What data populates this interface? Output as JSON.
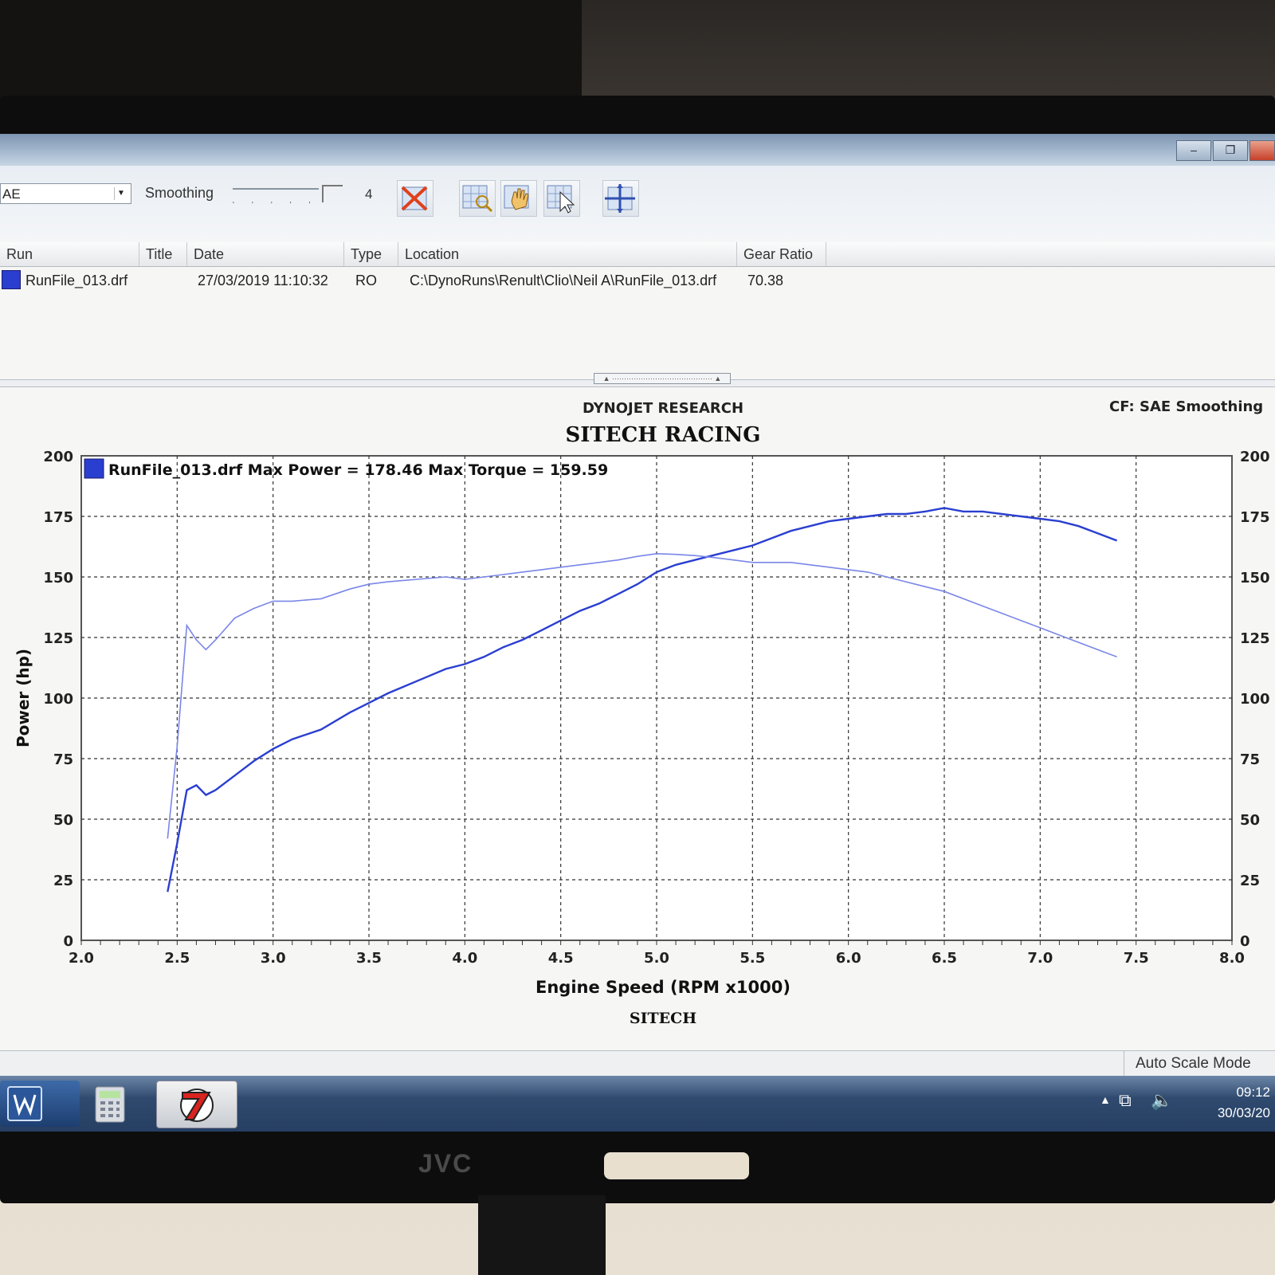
{
  "window": {
    "minimize_glyph": "–",
    "restore_glyph": "❐"
  },
  "toolbar": {
    "cf_value": "AE",
    "smoothing_label": "Smoothing",
    "smoothing_value": "4",
    "buttons": [
      "clear-runs-icon",
      "zoom-icon",
      "pan-hand-icon",
      "cursor-select-icon",
      "crosshair-icon"
    ]
  },
  "grid": {
    "headers": {
      "run": "Run",
      "title": "Title",
      "date": "Date",
      "type": "Type",
      "location": "Location",
      "gear_ratio": "Gear Ratio"
    },
    "rows": [
      {
        "run": "RunFile_013.drf",
        "title": "",
        "date": "27/03/2019 11:10:32",
        "type": "RO",
        "location": "C:\\DynoRuns\\Renult\\Clio\\Neil A\\RunFile_013.drf",
        "gear_ratio": "70.38",
        "color": "#2a3fd0"
      }
    ]
  },
  "status": {
    "auto_scale": "Auto Scale Mode"
  },
  "taskbar": {
    "time": "09:12",
    "date": "30/03/20"
  },
  "monitor": {
    "brand": "JVC"
  },
  "chart_data": {
    "type": "line",
    "header_small": "DYNOJET RESEARCH",
    "title": "SITECH RACING",
    "footer": "SITECH",
    "cf_info": "CF: SAE  Smoothing",
    "xlabel": "Engine Speed (RPM x1000)",
    "ylabel": "Power (hp)",
    "xlim": [
      2.0,
      8.0
    ],
    "ylim": [
      0,
      200
    ],
    "x_ticks": [
      "2.0",
      "2.5",
      "3.0",
      "3.5",
      "4.0",
      "4.5",
      "5.0",
      "5.5",
      "6.0",
      "6.5",
      "7.0",
      "7.5",
      "8.0"
    ],
    "y_ticks": [
      "0",
      "25",
      "50",
      "75",
      "100",
      "125",
      "150",
      "175",
      "200"
    ],
    "y2_ticks": [
      "0",
      "25",
      "50",
      "75",
      "100",
      "125",
      "150",
      "175",
      "200"
    ],
    "grid": true,
    "legend": {
      "position": "top-left",
      "text": "RunFile_013.drf Max Power = 178.46 Max Torque = 159.59"
    },
    "series": [
      {
        "role": "power",
        "color": "#2a3fd0",
        "x": [
          2.45,
          2.5,
          2.55,
          2.6,
          2.65,
          2.7,
          2.8,
          2.9,
          3.0,
          3.1,
          3.25,
          3.4,
          3.5,
          3.6,
          3.75,
          3.9,
          4.0,
          4.1,
          4.2,
          4.3,
          4.4,
          4.5,
          4.6,
          4.7,
          4.8,
          4.9,
          5.0,
          5.1,
          5.2,
          5.3,
          5.4,
          5.5,
          5.6,
          5.7,
          5.8,
          5.9,
          6.0,
          6.1,
          6.2,
          6.3,
          6.4,
          6.5,
          6.6,
          6.7,
          6.8,
          6.9,
          7.0,
          7.1,
          7.2,
          7.3,
          7.4
        ],
        "y": [
          20,
          40,
          62,
          64,
          60,
          62,
          68,
          74,
          79,
          83,
          87,
          94,
          98,
          102,
          107,
          112,
          114,
          117,
          121,
          124,
          128,
          132,
          136,
          139,
          143,
          147,
          152,
          155,
          157,
          159,
          161,
          163,
          166,
          169,
          171,
          173,
          174,
          175,
          176,
          176,
          177,
          178.46,
          177,
          177,
          176,
          175,
          174,
          173,
          171,
          168,
          165
        ]
      },
      {
        "role": "torque",
        "color": "#7a86e8",
        "x": [
          2.45,
          2.5,
          2.55,
          2.6,
          2.65,
          2.7,
          2.8,
          2.9,
          3.0,
          3.1,
          3.25,
          3.4,
          3.5,
          3.6,
          3.75,
          3.9,
          4.0,
          4.1,
          4.2,
          4.3,
          4.4,
          4.5,
          4.6,
          4.7,
          4.8,
          4.9,
          5.0,
          5.1,
          5.2,
          5.3,
          5.4,
          5.5,
          5.6,
          5.7,
          5.8,
          5.9,
          6.0,
          6.1,
          6.2,
          6.3,
          6.4,
          6.5,
          6.6,
          6.7,
          6.8,
          6.9,
          7.0,
          7.1,
          7.2,
          7.3,
          7.4
        ],
        "y": [
          42,
          80,
          130,
          124,
          120,
          124,
          133,
          137,
          140,
          140,
          141,
          145,
          147,
          148,
          149,
          150,
          149,
          150,
          151,
          152,
          153,
          154,
          155,
          156,
          157,
          158.5,
          159.59,
          159.3,
          158.8,
          158,
          157,
          156,
          156,
          156,
          155,
          154,
          153,
          152,
          150,
          148,
          146,
          144,
          141,
          138,
          135,
          132,
          129,
          126,
          123,
          120,
          117
        ]
      }
    ]
  }
}
